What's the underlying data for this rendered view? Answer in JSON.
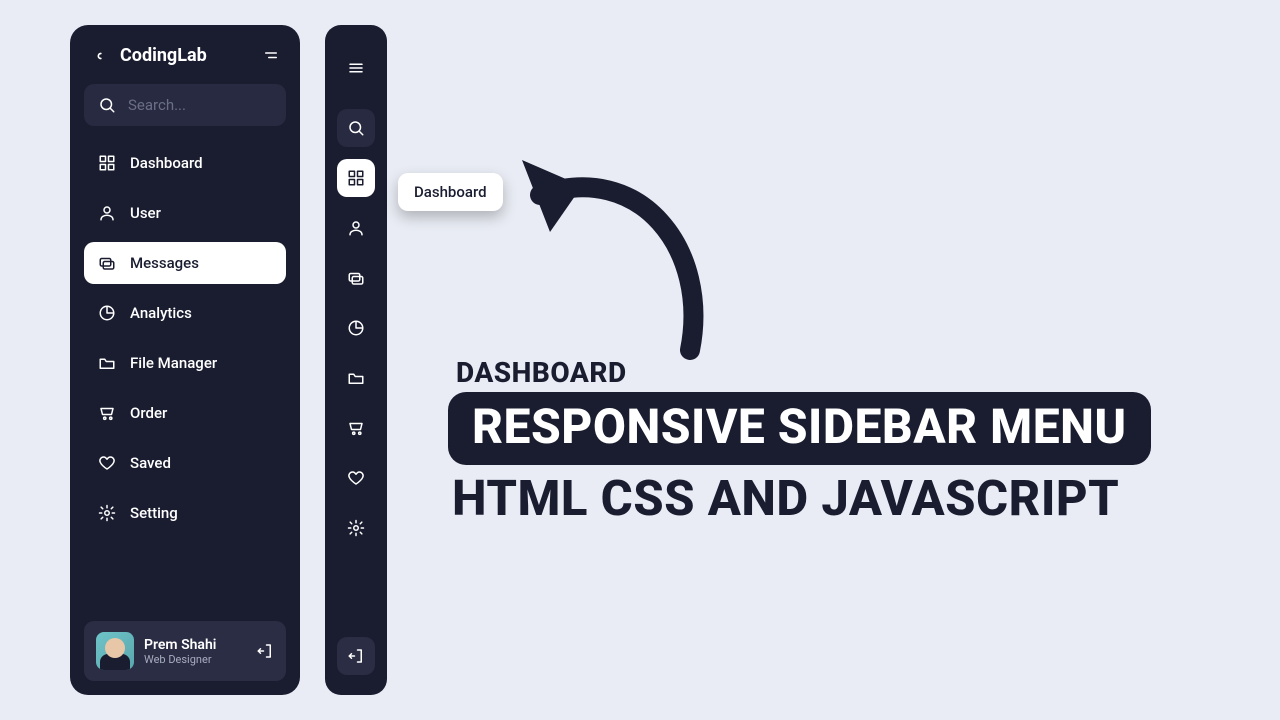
{
  "brand": {
    "name": "CodingLab"
  },
  "search": {
    "placeholder": "Search..."
  },
  "nav": {
    "items": [
      {
        "label": "Dashboard"
      },
      {
        "label": "User"
      },
      {
        "label": "Messages"
      },
      {
        "label": "Analytics"
      },
      {
        "label": "File Manager"
      },
      {
        "label": "Order"
      },
      {
        "label": "Saved"
      },
      {
        "label": "Setting"
      }
    ],
    "active_expanded": "Messages",
    "active_collapsed": "Dashboard"
  },
  "tooltip": {
    "label": "Dashboard"
  },
  "profile": {
    "name": "Prem Shahi",
    "role": "Web Designer"
  },
  "hero": {
    "small": "DASHBOARD",
    "pill": "RESPONSIVE SIDEBAR MENU",
    "sub": "HTML CSS AND JAVASCRIPT"
  },
  "colors": {
    "bg_dark": "#1a1d30",
    "bg_page": "#e9ecf4",
    "panel": "#272a40"
  }
}
